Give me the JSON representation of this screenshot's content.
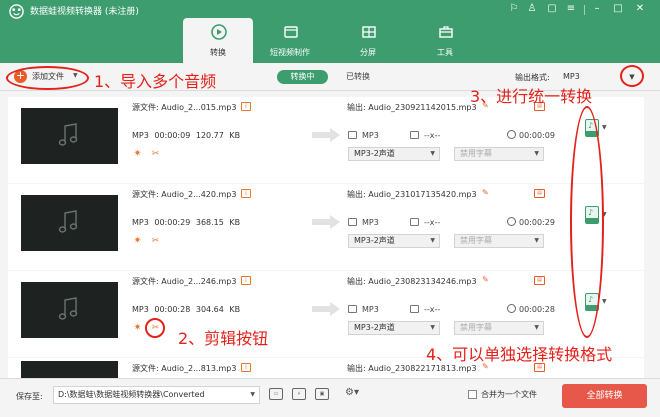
{
  "window": {
    "title": "数据蛙视频转换器 (未注册)"
  },
  "tabs": [
    {
      "label": "转换",
      "active": true
    },
    {
      "label": "短视频制作",
      "active": false
    },
    {
      "label": "分屏",
      "active": false
    },
    {
      "label": "工具",
      "active": false
    }
  ],
  "toolbar": {
    "add_files": "添加文件",
    "seg_converting": "转换中",
    "seg_converted": "已转换",
    "output_format_label": "输出格式:",
    "output_format_value": "MP3"
  },
  "rows": [
    {
      "source": "源文件: Audio_2...015.mp3",
      "format": "MP3",
      "duration": "00:00:09",
      "size": "120.77 KB",
      "output": "输出: Audio_230921142015.mp3",
      "out_format": "MP3",
      "out_res": "--x--",
      "out_duration": "00:00:09",
      "audio_track": "MP3-2声道",
      "subtitle": "禁用字幕",
      "format_badge": "MP3"
    },
    {
      "source": "源文件: Audio_2...420.mp3",
      "format": "MP3",
      "duration": "00:00:29",
      "size": "368.15 KB",
      "output": "输出: Audio_231017135420.mp3",
      "out_format": "MP3",
      "out_res": "--x--",
      "out_duration": "00:00:29",
      "audio_track": "MP3-2声道",
      "subtitle": "禁用字幕",
      "format_badge": "MP3"
    },
    {
      "source": "源文件: Audio_2...246.mp3",
      "format": "MP3",
      "duration": "00:00:28",
      "size": "304.64 KB",
      "output": "输出: Audio_230823134246.mp3",
      "out_format": "MP3",
      "out_res": "--x--",
      "out_duration": "00:00:28",
      "audio_track": "MP3-2声道",
      "subtitle": "禁用字幕",
      "format_badge": "MP3"
    },
    {
      "source": "源文件: Audio_2...813.mp3",
      "output": "输出: Audio_230822171813.mp3"
    }
  ],
  "bottom": {
    "save_to_label": "保存至:",
    "save_path": "D:\\数据蛙\\数据蛙视频转换器\\Converted",
    "merge_label": "合并为一个文件",
    "convert_all": "全部转换"
  },
  "annotations": {
    "a1": "1、导入多个音频",
    "a2": "2、剪辑按钮",
    "a3": "3、进行统一转换",
    "a4": "4、可以单独选择转换格式"
  },
  "colors": {
    "brand_green": "#3d9d6e",
    "accent_orange": "#e85c28",
    "convert_red": "#e8584a",
    "annotation_red": "#e3221b"
  }
}
